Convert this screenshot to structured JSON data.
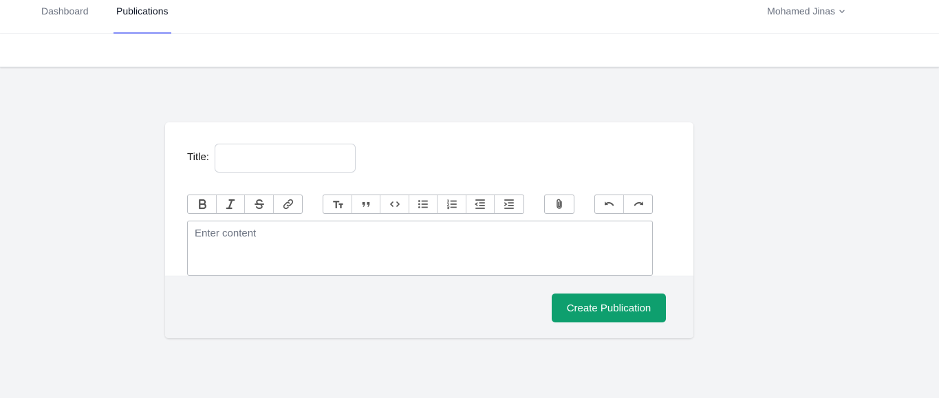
{
  "nav": {
    "links": [
      {
        "label": "Dashboard",
        "active": false
      },
      {
        "label": "Publications",
        "active": true
      }
    ],
    "user_name": "Mohamed Jinas",
    "active_underline_color": "#818cf8"
  },
  "form": {
    "title_label": "Title:",
    "title_value": "",
    "content_placeholder": "Enter content",
    "toolbar": {
      "text_group": [
        "bold-icon",
        "italic-icon",
        "strikethrough-icon",
        "link-icon"
      ],
      "block_group": [
        "heading-icon",
        "quote-icon",
        "code-icon",
        "bullet-list-icon",
        "numbered-list-icon",
        "outdent-icon",
        "indent-icon"
      ],
      "file_group": [
        "attach-icon"
      ],
      "history_group": [
        "undo-icon",
        "redo-icon"
      ]
    },
    "submit_label": "Create Publication",
    "submit_color": "#0e9f6e"
  }
}
